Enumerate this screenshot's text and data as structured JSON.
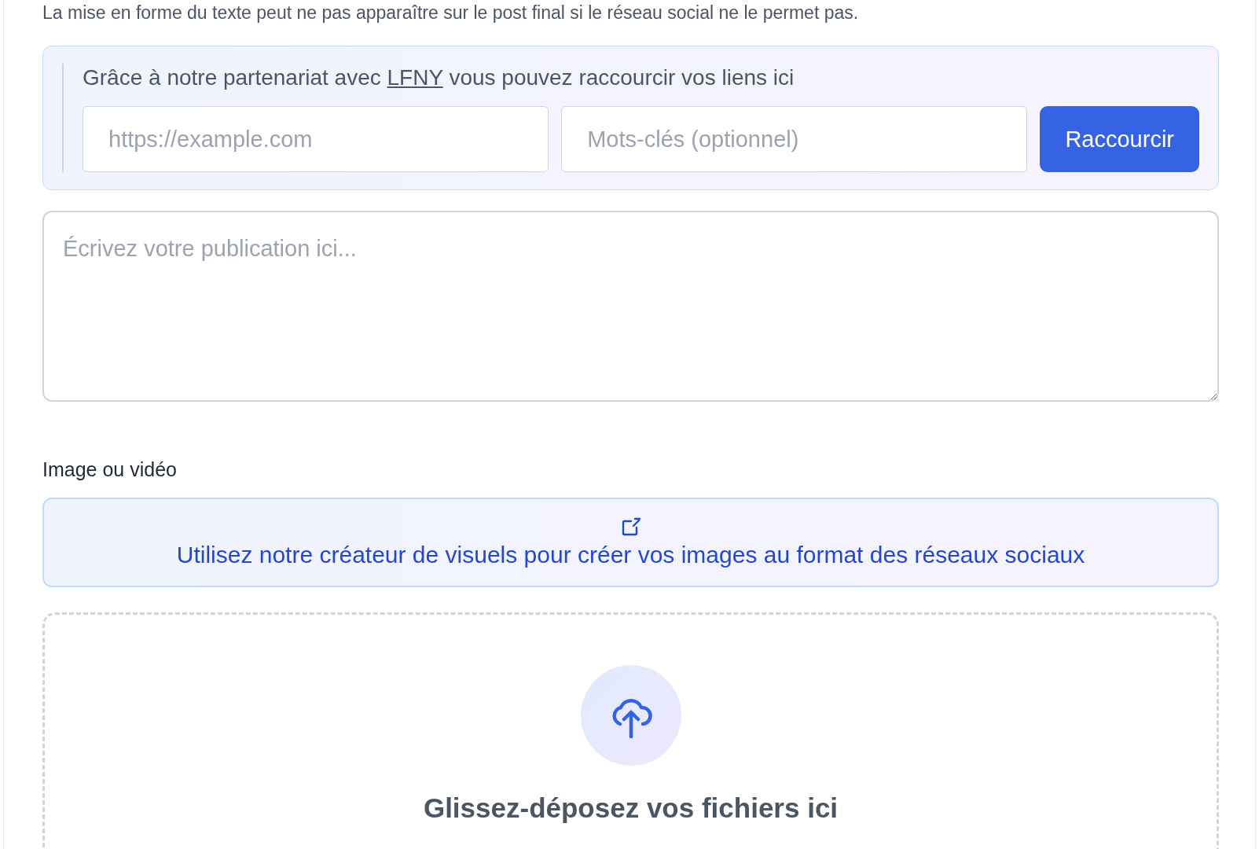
{
  "notice": "La mise en forme du texte peut ne pas apparaître sur le post final si le réseau social ne le permet pas.",
  "shortener": {
    "text_before": "Grâce à notre partenariat avec",
    "link": "LFNY",
    "text_after": "vous pouvez raccourcir vos liens ici",
    "url_placeholder": "https://example.com",
    "keywords_placeholder": "Mots-clés (optionnel)",
    "button": "Raccourcir"
  },
  "post": {
    "placeholder": "Écrivez votre publication ici..."
  },
  "media": {
    "label": "Image ou vidéo",
    "visual_creator_link": "Utilisez notre créateur de visuels pour créer vos images au format des réseaux sociaux",
    "dropzone_title": "Glissez-déposez vos fichiers ici"
  }
}
